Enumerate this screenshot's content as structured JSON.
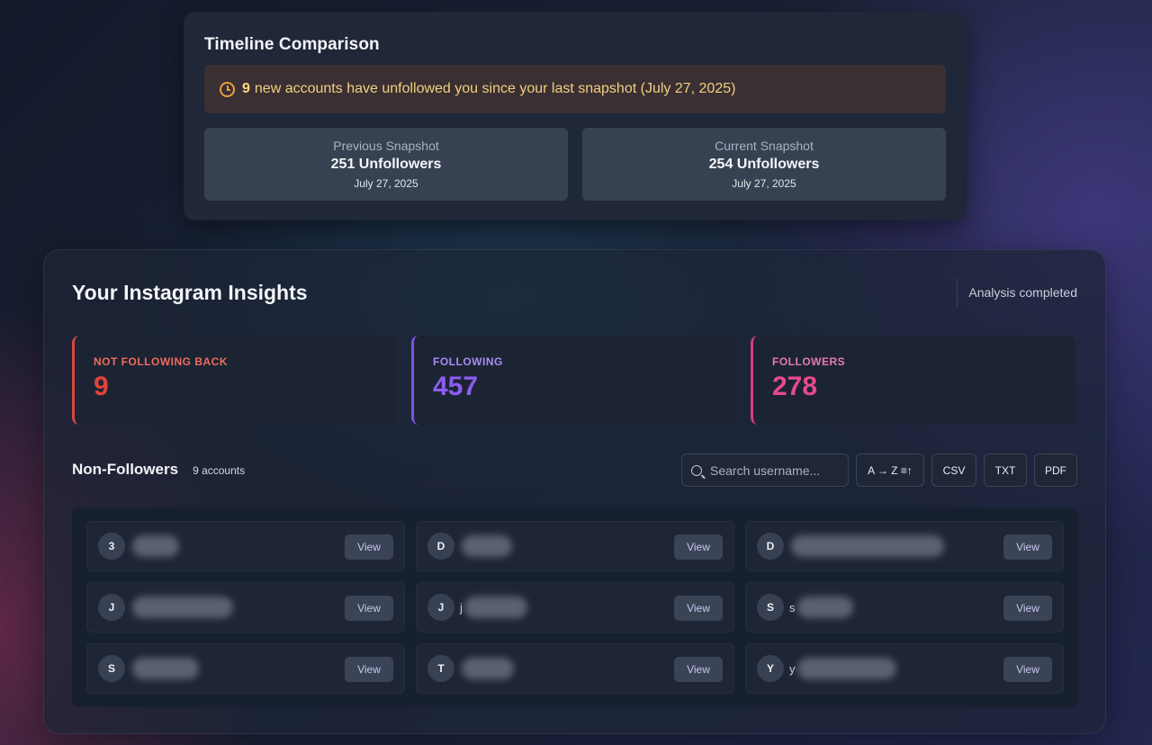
{
  "timeline": {
    "title": "Timeline Comparison",
    "alert_count": "9",
    "alert_text": "new accounts have unfollowed you since your last snapshot (July 27, 2025)",
    "previous": {
      "label": "Previous Snapshot",
      "value": "251 Unfollowers",
      "date": "July 27, 2025"
    },
    "current": {
      "label": "Current Snapshot",
      "value": "254 Unfollowers",
      "date": "July 27, 2025"
    }
  },
  "insights": {
    "title": "Your Instagram Insights",
    "status": "Analysis completed",
    "stats": [
      {
        "label": "NOT FOLLOWING BACK",
        "value": "9"
      },
      {
        "label": "FOLLOWING",
        "value": "457"
      },
      {
        "label": "FOLLOWERS",
        "value": "278"
      }
    ]
  },
  "non_followers": {
    "title": "Non-Followers",
    "count": "9 accounts",
    "search_placeholder": "Search username...",
    "sort_label": "A → Z ≡↑",
    "export": {
      "csv": "CSV",
      "txt": "TXT",
      "pdf": "PDF"
    },
    "view_label": "View",
    "items": [
      {
        "initial": "3",
        "prefix": ""
      },
      {
        "initial": "D",
        "prefix": ""
      },
      {
        "initial": "D",
        "prefix": ""
      },
      {
        "initial": "J",
        "prefix": ""
      },
      {
        "initial": "J",
        "prefix": "j"
      },
      {
        "initial": "S",
        "prefix": "s"
      },
      {
        "initial": "S",
        "prefix": ""
      },
      {
        "initial": "T",
        "prefix": ""
      },
      {
        "initial": "Y",
        "prefix": "y"
      }
    ]
  }
}
